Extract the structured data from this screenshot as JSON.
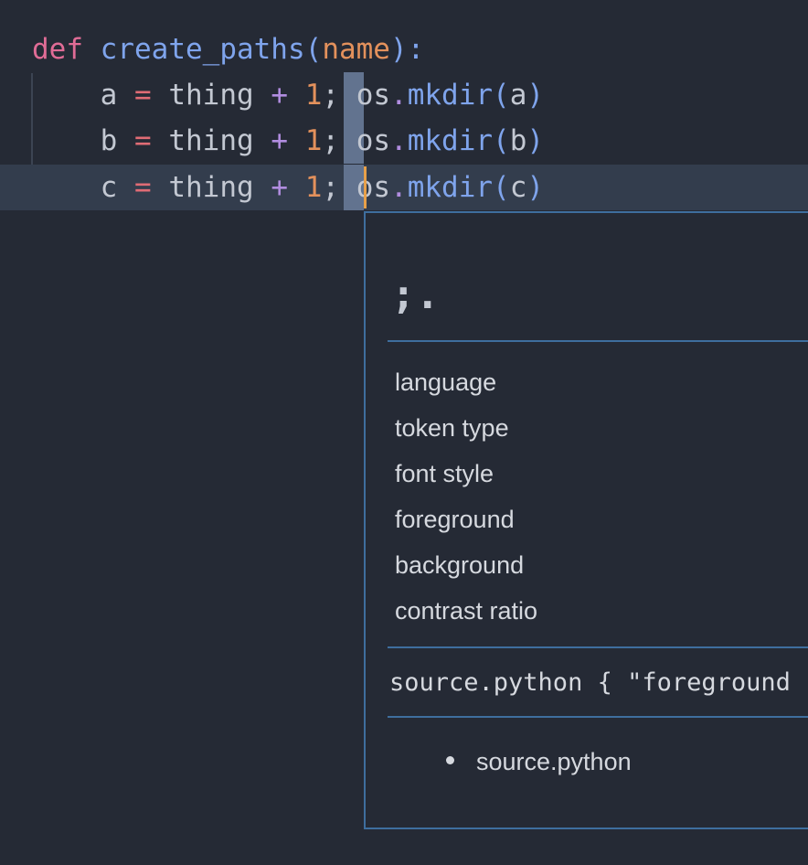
{
  "code": {
    "line1": {
      "keyword": "def",
      "function_name": "create_paths",
      "open_paren": "(",
      "param": "name",
      "close_paren_colon": "):"
    },
    "line2": {
      "var": "a",
      "eq": "=",
      "ident": "thing",
      "plus": "+",
      "num": "1",
      "semi": ";",
      "module": "os",
      "dot": ".",
      "method": "mkdir",
      "open": "(",
      "arg": "a",
      "close": ")"
    },
    "line3": {
      "var": "b",
      "eq": "=",
      "ident": "thing",
      "plus": "+",
      "num": "1",
      "semi": ";",
      "module": "os",
      "dot": ".",
      "method": "mkdir",
      "open": "(",
      "arg": "b",
      "close": ")"
    },
    "line4": {
      "var": "c",
      "eq": "=",
      "ident": "thing",
      "plus": "+",
      "num": "1",
      "semi": ";",
      "module": "os",
      "dot": ".",
      "method": "mkdir",
      "open": "(",
      "arg": "c",
      "close": ")"
    }
  },
  "inspector": {
    "token_preview": ";.",
    "properties": [
      "language",
      "token type",
      "font style",
      "foreground",
      "background",
      "contrast ratio"
    ],
    "scope_rule": "source.python { \"foreground",
    "scopes": [
      "source.python"
    ]
  },
  "colors": {
    "editor_background": "#252a35",
    "current_line": "#333d4d",
    "selection": "#62738f",
    "caret": "#e7a049",
    "panel_border": "#3e6e9e"
  }
}
